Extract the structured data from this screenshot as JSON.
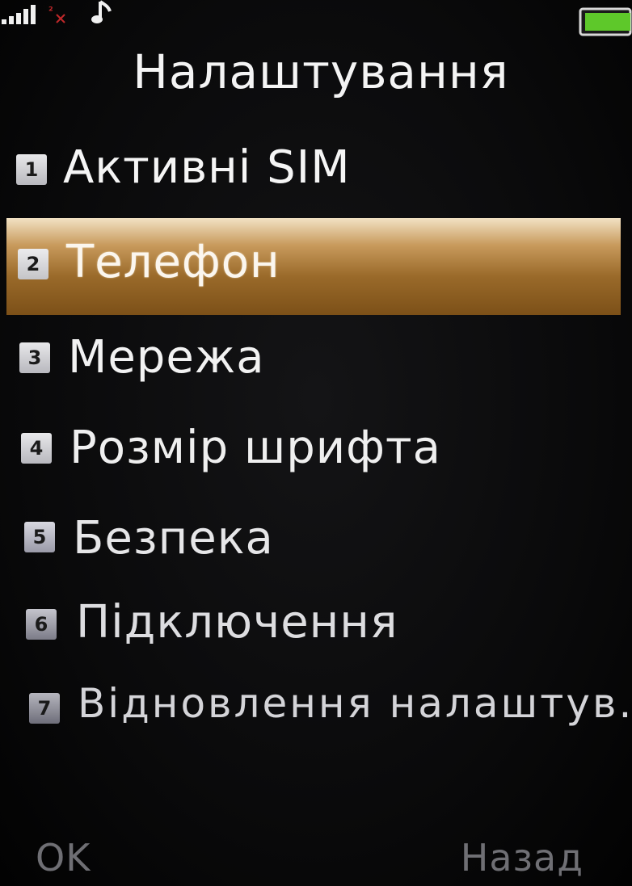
{
  "statusbar": {
    "signal_icon": "signal-bars-icon",
    "sim2_icon": "sim2-no-signal-icon",
    "music_icon": "music-note-icon",
    "battery_icon": "battery-icon",
    "battery_color": "#5ec82a"
  },
  "title": "Налаштування",
  "menu": {
    "items": [
      {
        "num": "1",
        "label": "Активні SIM"
      },
      {
        "num": "2",
        "label": "Телефон"
      },
      {
        "num": "3",
        "label": "Мережа"
      },
      {
        "num": "4",
        "label": "Розмір шрифта"
      },
      {
        "num": "5",
        "label": "Безпека"
      },
      {
        "num": "6",
        "label": "Підключення"
      },
      {
        "num": "7",
        "label": "Відновлення налаштув..."
      }
    ],
    "selected_index": 1,
    "highlight_color": "#c89a5c"
  },
  "softkeys": {
    "left": "OK",
    "right": "Назад"
  }
}
